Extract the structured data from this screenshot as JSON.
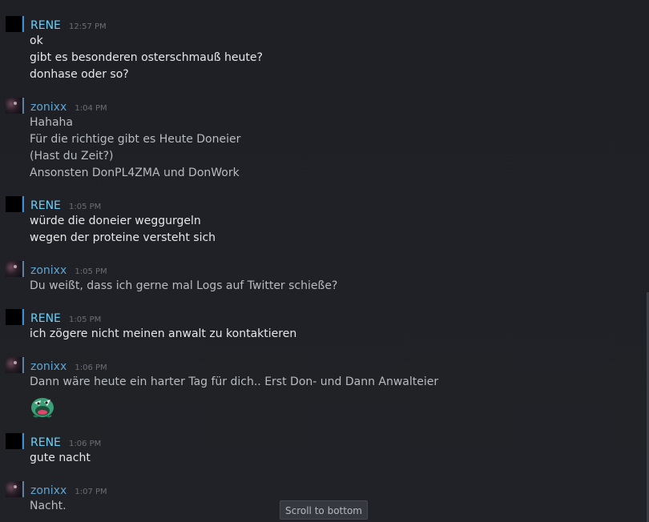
{
  "messages": [
    {
      "author": "RENE",
      "time": "12:57 PM",
      "lines": [
        "ok",
        "gibt es besonderen osterschmauß heute?",
        "donhase oder so?"
      ]
    },
    {
      "author": "zonixx",
      "time": "1:04 PM",
      "lines": [
        "Hahaha",
        "Für die richtige gibt es Heute Doneier",
        "(Hast du Zeit?)",
        "Ansonsten DonPL4ZMA und DonWork"
      ]
    },
    {
      "author": "RENE",
      "time": "1:05 PM",
      "lines": [
        "würde die doneier weggurgeln",
        "wegen der proteine versteht sich"
      ]
    },
    {
      "author": "zonixx",
      "time": "1:05 PM",
      "lines": [
        "Du weißt, dass ich gerne mal Logs auf Twitter schieße?"
      ]
    },
    {
      "author": "RENE",
      "time": "1:05 PM",
      "lines": [
        "ich zögere nicht meinen anwalt zu kontaktieren"
      ]
    },
    {
      "author": "zonixx",
      "time": "1:06 PM",
      "lines": [
        "Dann wäre heute ein harter Tag für dich.. Erst Don- und Dann Anwalteier"
      ],
      "emote": "green-frog-emote"
    },
    {
      "author": "RENE",
      "time": "1:06 PM",
      "lines": [
        "gute nacht"
      ]
    },
    {
      "author": "zonixx",
      "time": "1:07 PM",
      "lines": [
        "Nacht."
      ]
    }
  ],
  "scroll_button": {
    "label": "Scroll to bottom"
  },
  "colors": {
    "background": "#1f2126",
    "rene_name": "#6dcff6",
    "zonixx_name": "#61a4d0",
    "text": "#e6e7e9"
  }
}
